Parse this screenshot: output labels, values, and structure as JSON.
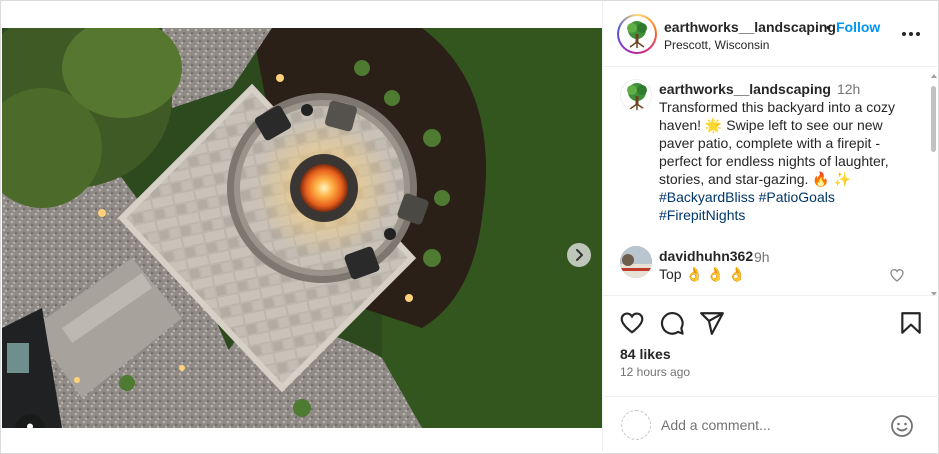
{
  "header": {
    "username": "earthworks__landscaping",
    "separator": "•",
    "follow_label": "Follow",
    "location": "Prescott, Wisconsin",
    "more_icon": "more-horizontal-icon"
  },
  "caption": {
    "username": "earthworks__landscaping",
    "time": "12h",
    "text": "Transformed this backyard into a cozy haven! 🌟 Swipe left to see our new paver patio, complete with a firepit - perfect for endless nights of laughter, stories, and star-gazing. 🔥 ✨",
    "hashtags": [
      "#BackyardBliss",
      "#PatioGoals",
      "#FirepitNights"
    ]
  },
  "comments": [
    {
      "username": "davidhuhn362",
      "time": "9h",
      "text": "Top 👌 👌 👌"
    }
  ],
  "actions": {
    "like_icon": "heart-icon",
    "comment_icon": "comment-icon",
    "share_icon": "share-icon",
    "save_icon": "bookmark-icon"
  },
  "likes": "84 likes",
  "posted_ago": "12 hours ago",
  "add_comment": {
    "placeholder": "Add a comment..."
  },
  "carousel": {
    "slide_count": 4,
    "active_slide": 1
  },
  "colors": {
    "follow": "#0095f6",
    "hashtag": "#00376b",
    "muted": "#737373",
    "text": "#262626"
  }
}
